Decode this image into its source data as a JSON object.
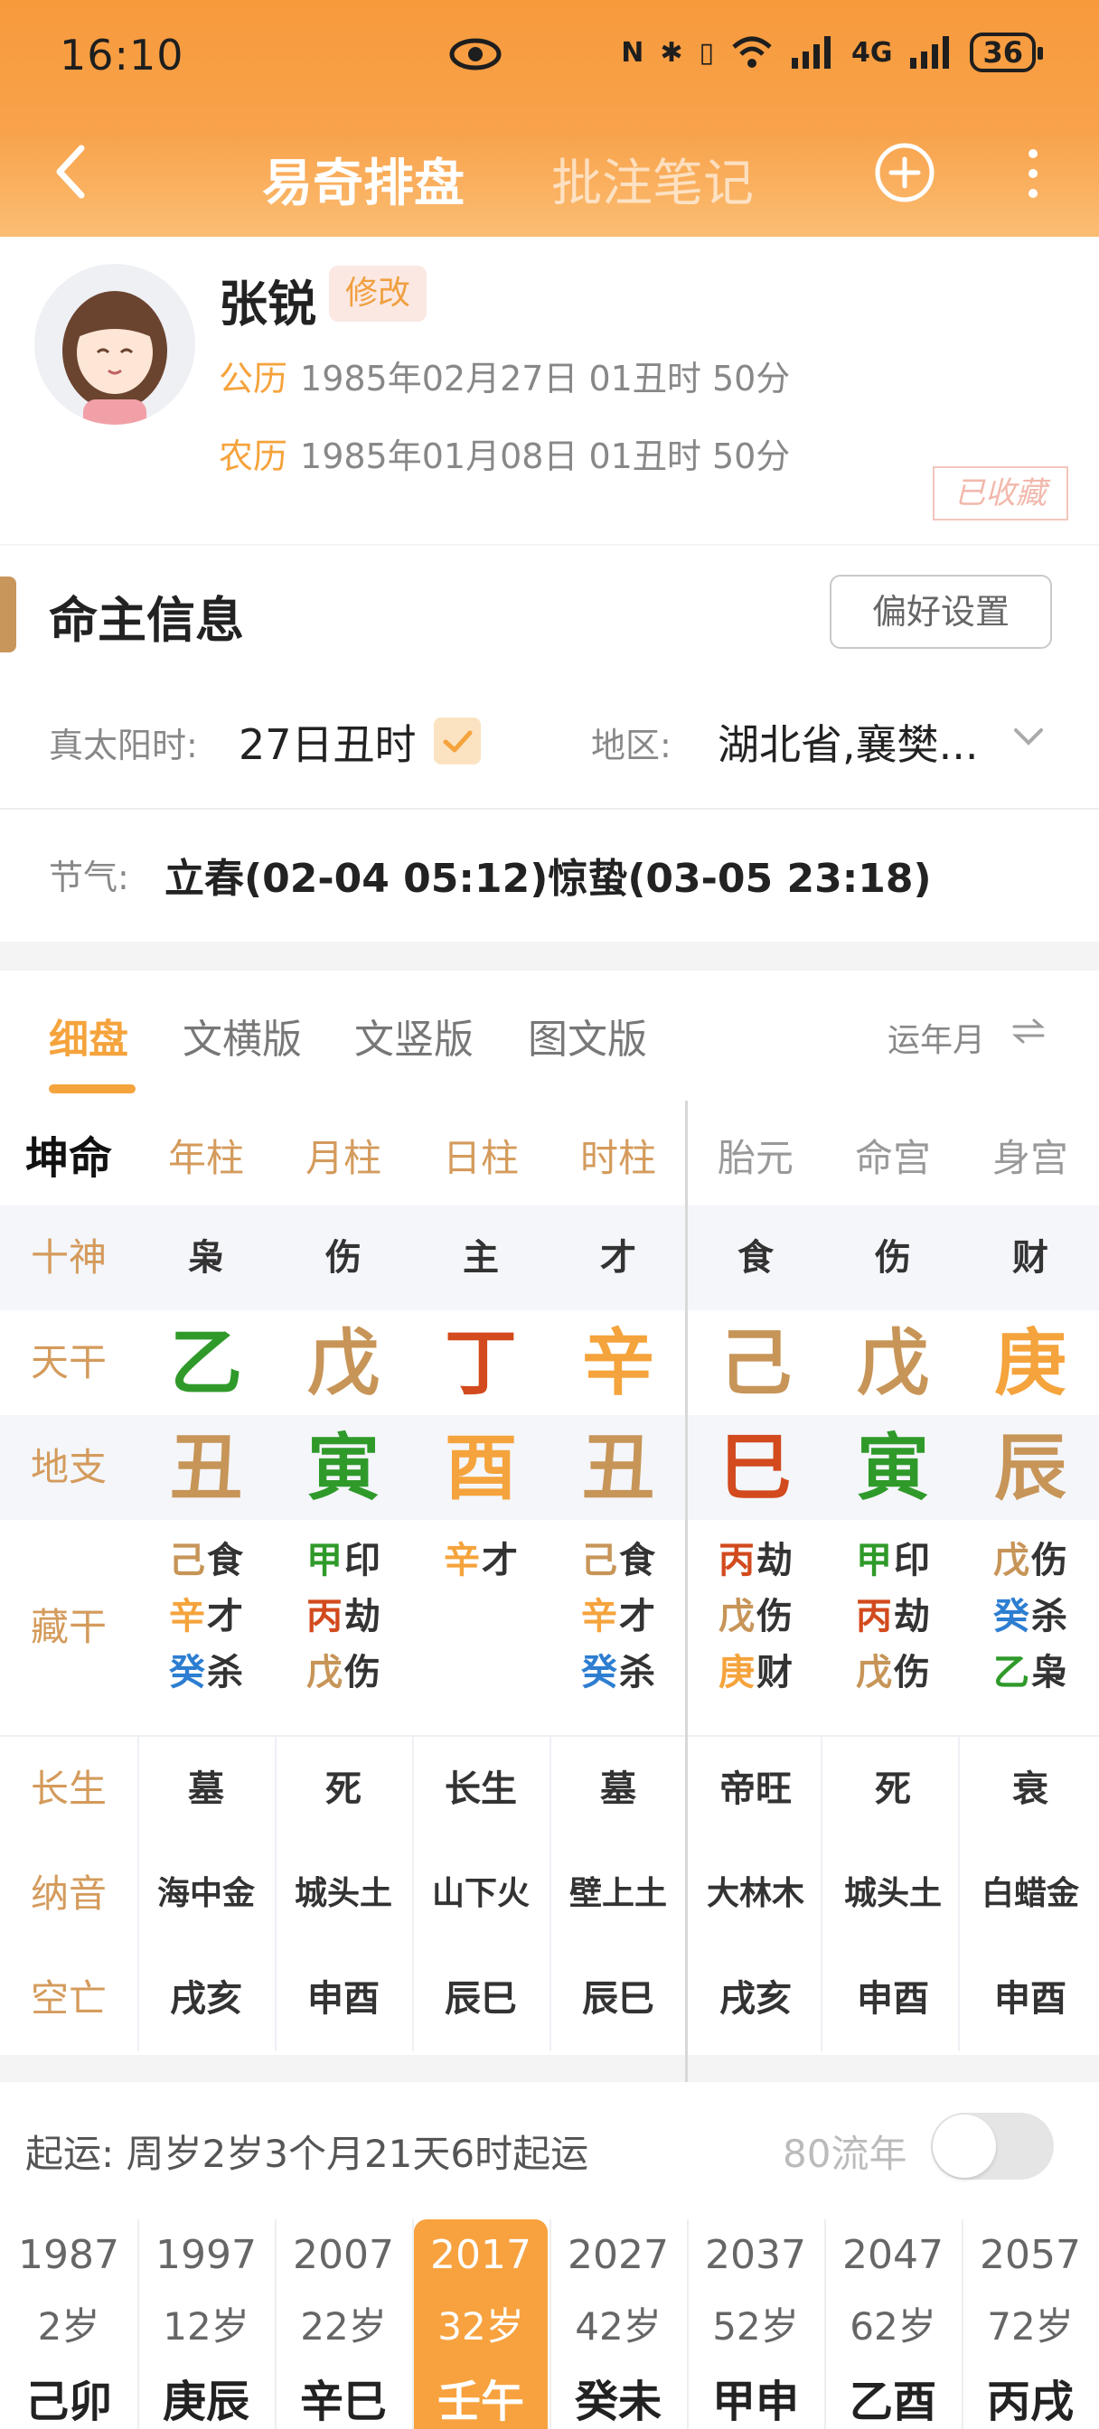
{
  "status_bar": {
    "time": "16:10",
    "network": "4G",
    "battery": "36"
  },
  "nav": {
    "tab_active": "易奇排盘",
    "tab_other": "批注笔记"
  },
  "profile": {
    "name": "张锐",
    "edit_label": "修改",
    "solar_label": "公历",
    "solar_date": "1985年02月27日 01丑时 50分",
    "lunar_label": "农历",
    "lunar_date": "1985年01月08日 01丑时 50分",
    "stamp": "已收藏"
  },
  "info": {
    "title": "命主信息",
    "pref_button": "偏好设置",
    "solar_time_label": "真太阳时:",
    "solar_time_value": "27日丑时",
    "region_label": "地区:",
    "region_value": "湖北省,襄樊...",
    "jieqi_label": "节气:",
    "jieqi_value": "立春(02-04 05:12)惊蛰(03-05 23:18)"
  },
  "chart_tabs": [
    "细盘",
    "文横版",
    "文竖版",
    "图文版"
  ],
  "chart_right_label": "运年月",
  "chart": {
    "corner": "坤命",
    "headers": [
      "年柱",
      "月柱",
      "日柱",
      "时柱",
      "胎元",
      "命宫",
      "身宫"
    ],
    "shishen_label": "十神",
    "shishen": [
      "枭",
      "伤",
      "主",
      "才",
      "食",
      "伤",
      "财"
    ],
    "tiangan_label": "天干",
    "tiangan": [
      "乙",
      "戊",
      "丁",
      "辛",
      "己",
      "戊",
      "庚"
    ],
    "dizhi_label": "地支",
    "dizhi": [
      "丑",
      "寅",
      "酉",
      "丑",
      "巳",
      "寅",
      "辰"
    ],
    "canggan_label": "藏干",
    "canggan": [
      [
        [
          "己",
          "食"
        ],
        [
          "辛",
          "才"
        ],
        [
          "癸",
          "杀"
        ]
      ],
      [
        [
          "甲",
          "印"
        ],
        [
          "丙",
          "劫"
        ],
        [
          "戊",
          "伤"
        ]
      ],
      [
        [
          "辛",
          "才"
        ]
      ],
      [
        [
          "己",
          "食"
        ],
        [
          "辛",
          "才"
        ],
        [
          "癸",
          "杀"
        ]
      ],
      [
        [
          "丙",
          "劫"
        ],
        [
          "戊",
          "伤"
        ],
        [
          "庚",
          "财"
        ]
      ],
      [
        [
          "甲",
          "印"
        ],
        [
          "丙",
          "劫"
        ],
        [
          "戊",
          "伤"
        ]
      ],
      [
        [
          "戊",
          "伤"
        ],
        [
          "癸",
          "杀"
        ],
        [
          "乙",
          "枭"
        ]
      ]
    ],
    "changsheng_label": "长生",
    "changsheng": [
      "墓",
      "死",
      "长生",
      "墓",
      "帝旺",
      "死",
      "衰"
    ],
    "nayin_label": "纳音",
    "nayin": [
      "海中金",
      "城头土",
      "山下火",
      "壁上土",
      "大林木",
      "城头土",
      "白蜡金"
    ],
    "kongwang_label": "空亡",
    "kongwang": [
      "戌亥",
      "申酉",
      "辰巳",
      "辰巳",
      "戌亥",
      "申酉",
      "申酉"
    ]
  },
  "colors": {
    "乙": "#2f9a2a",
    "甲": "#2f9a2a",
    "寅": "#2f9a2a",
    "戊": "#c79558",
    "己": "#c79558",
    "丑": "#c79558",
    "辰": "#c79558",
    "丁": "#d24a1d",
    "丙": "#d24a1d",
    "巳": "#d24a1d",
    "辛": "#f5a33c",
    "庚": "#f5a33c",
    "酉": "#f5a33c",
    "癸": "#2d7ed1"
  },
  "luck": {
    "start_text": "起运: 周岁2岁3个月21天6时起运",
    "liunian_label": "80流年",
    "decades": [
      {
        "year": "1987",
        "age": "2岁",
        "gz": "己卯"
      },
      {
        "year": "1997",
        "age": "12岁",
        "gz": "庚辰"
      },
      {
        "year": "2007",
        "age": "22岁",
        "gz": "辛巳"
      },
      {
        "year": "2017",
        "age": "32岁",
        "gz": "壬午",
        "active": true
      },
      {
        "year": "2027",
        "age": "42岁",
        "gz": "癸未"
      },
      {
        "year": "2037",
        "age": "52岁",
        "gz": "甲申"
      },
      {
        "year": "2047",
        "age": "62岁",
        "gz": "乙酉"
      },
      {
        "year": "2057",
        "age": "72岁",
        "gz": "丙戌"
      }
    ]
  }
}
